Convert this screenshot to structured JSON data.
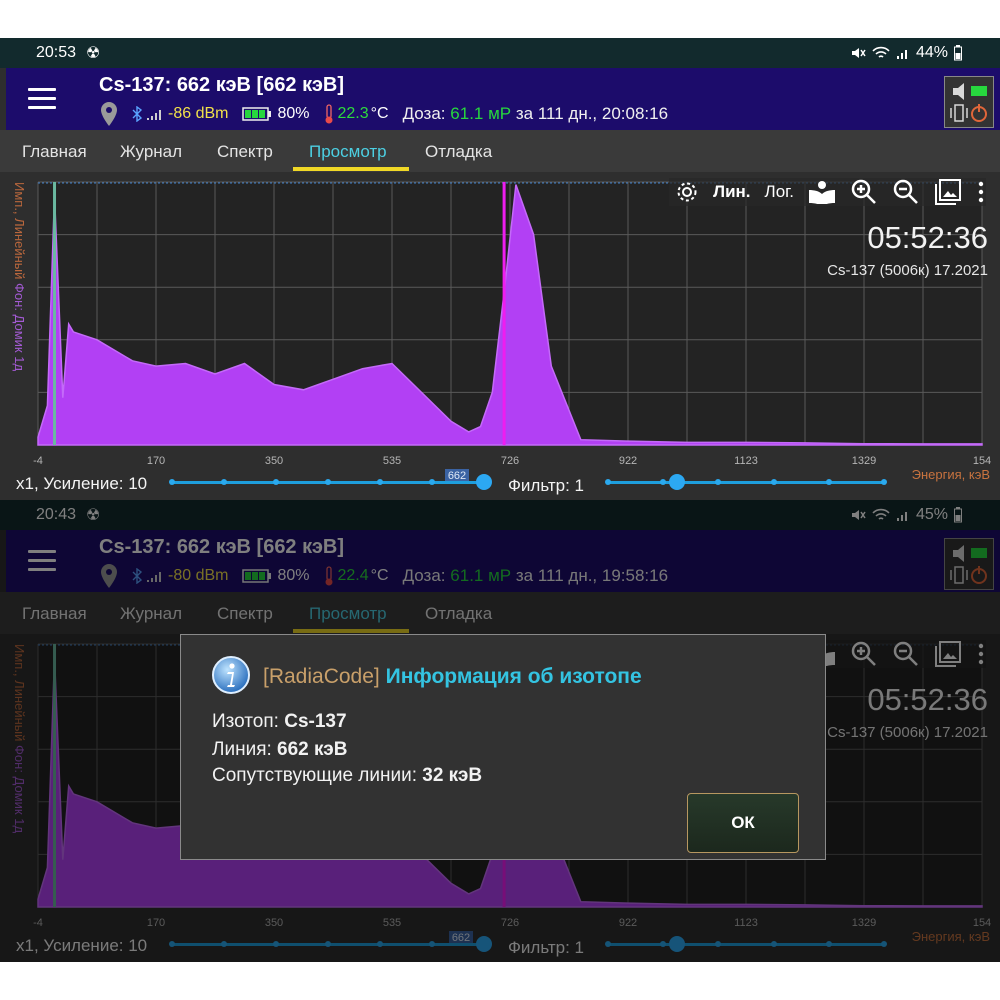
{
  "shots": [
    {
      "status": {
        "time": "20:53",
        "battery": "44%",
        "rad_glyph": "☢"
      },
      "title": "Cs-137: 662 кэВ [662 кэВ]",
      "signal": "-86 dBm",
      "battery_dev": "80%",
      "temp_value": "22.3",
      "temp_unit": "°C",
      "dose_label": "Доза:",
      "dose_value": "61.1 мР",
      "dose_suffix": "за 111 дн., 20:08:16",
      "peak_label": "662",
      "dimmed": false
    },
    {
      "status": {
        "time": "20:43",
        "battery": "45%",
        "rad_glyph": "☢"
      },
      "title": "Cs-137: 662 кэВ [662 кэВ]",
      "signal": "-80 dBm",
      "battery_dev": "80%",
      "temp_value": "22.4",
      "temp_unit": "°C",
      "dose_label": "Доза:",
      "dose_value": "61.1 мР",
      "dose_suffix": "за 111 дн., 19:58:16",
      "peak_label": "662",
      "dimmed": true
    }
  ],
  "tabs": [
    "Главная",
    "Журнал",
    "Спектр",
    "Просмотр",
    "Отладка"
  ],
  "active_tab": 3,
  "toolbar": {
    "lin": "Лин.",
    "log": "Лог."
  },
  "y_axis_label": "Имп., Линейный",
  "y_axis_series": "Фон: Домик 1д",
  "measure_time": "05:52:36",
  "source_label": "Cs-137 (5006к) 17.2021",
  "energy_label": "Энергия, кэВ",
  "gain_label": "x1, Усиление: 10",
  "filter_label": "Фильтр: 1",
  "chart_data": {
    "type": "area",
    "series": [],
    "x_unit": "tick index; printed labels in x_tick_labels",
    "x_tick_labels": [
      "-4",
      "170",
      "350",
      "535",
      "726",
      "922",
      "1123",
      "1329",
      "154"
    ],
    "x_ticks": [
      0,
      1,
      2,
      3,
      4,
      5,
      6,
      7,
      8
    ],
    "x": [
      0,
      0.08,
      0.14,
      0.21,
      0.26,
      0.3,
      0.5,
      0.8,
      1.0,
      1.25,
      1.5,
      1.75,
      2.0,
      2.25,
      2.5,
      2.75,
      3.0,
      3.25,
      3.5,
      3.65,
      3.75,
      3.85,
      3.95,
      4.05,
      4.2,
      4.35,
      4.6,
      5.0,
      5.5,
      6.0,
      6.5,
      7.0,
      7.5,
      8.0
    ],
    "y": [
      0.03,
      0.15,
      0.95,
      0.18,
      0.46,
      0.43,
      0.4,
      0.32,
      0.3,
      0.31,
      0.27,
      0.31,
      0.23,
      0.21,
      0.25,
      0.29,
      0.31,
      0.2,
      0.09,
      0.05,
      0.07,
      0.2,
      0.58,
      0.99,
      0.8,
      0.3,
      0.02,
      0.015,
      0.01,
      0.01,
      0.008,
      0.005,
      0.004,
      0.004
    ],
    "y_range": [
      0,
      1
    ],
    "marker_lines": [
      {
        "x": 0.14,
        "color": "#6ab8a0"
      },
      {
        "x": 3.95,
        "color": "#ee1df0"
      }
    ],
    "grid": true,
    "colors": {
      "fill": "#b240f4",
      "grid": "#5a5a5a"
    }
  },
  "slider_gain": {
    "value_fraction": 1.0,
    "steps": 6
  },
  "slider_filter": {
    "value_fraction": 0.25,
    "steps": 5
  },
  "dialog": {
    "brand": "[RadiaCode]",
    "title": "Информация об изотопе",
    "isotope_label": "Изотоп:",
    "isotope_value": "Cs-137",
    "line_label": "Линия:",
    "line_value": "662 кэВ",
    "assoc_label": "Сопутствующие линии:",
    "assoc_value": "32 кэВ",
    "ok_label": "ОК"
  }
}
